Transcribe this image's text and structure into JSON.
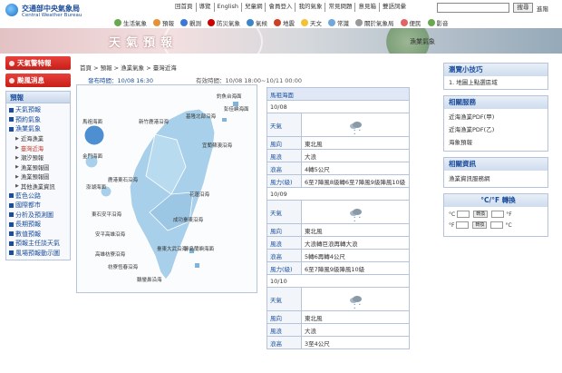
{
  "header": {
    "logo_title": "交通部中央氣象局",
    "logo_subtitle": "Central Weather Bureau",
    "top_links": [
      "回首頁",
      "導覽",
      "English",
      "兒童網",
      "會員登入",
      "我的氣象",
      "常見問題",
      "意見箱",
      "雙語詞彙"
    ],
    "search_button": "搜尋",
    "advanced_search": "進階",
    "nav": [
      {
        "label": "生活氣象",
        "icon": "leaf-icon",
        "color": "#6aa84f"
      },
      {
        "label": "預報",
        "icon": "forecast-icon",
        "color": "#e69138"
      },
      {
        "label": "觀測",
        "icon": "observation-icon",
        "color": "#3c78d8"
      },
      {
        "label": "防災氣象",
        "icon": "disaster-icon",
        "color": "#cc0000"
      },
      {
        "label": "氣候",
        "icon": "climate-icon",
        "color": "#3d85c6"
      },
      {
        "label": "地震",
        "icon": "earthquake-icon",
        "color": "#cc4125"
      },
      {
        "label": "天文",
        "icon": "astronomy-icon",
        "color": "#f1c232"
      },
      {
        "label": "常識",
        "icon": "knowledge-icon",
        "color": "#6fa8dc"
      },
      {
        "label": "關於氣象局",
        "icon": "about-icon",
        "color": "#999999"
      },
      {
        "label": "便民",
        "icon": "service-icon",
        "color": "#e06666"
      },
      {
        "label": "影音",
        "icon": "video-icon",
        "color": "#6aa84f"
      }
    ]
  },
  "banner": {
    "title": "天氣預報",
    "subtitle": "漁業氣象"
  },
  "sidebar": {
    "alerts": [
      "天氣警特報",
      "颱風消息"
    ],
    "section_title": "預報",
    "items_top": [
      "天氣預報",
      "預約氣象",
      "漁業氣象"
    ],
    "sub_items": [
      {
        "label": "近海漁業",
        "active": false
      },
      {
        "label": "臺灣近海",
        "active": true
      },
      {
        "label": "潮汐預報",
        "active": false
      },
      {
        "label": "漁業預報圖",
        "active": false
      },
      {
        "label": "漁業預報圖",
        "active": false
      },
      {
        "label": "其他漁業資訊",
        "active": false
      }
    ],
    "items_bottom": [
      "藍色公路",
      "國際都市",
      "分析及預測圖",
      "長期預報",
      "數值預報",
      "預報主任談天氣",
      "風場預報動示圖"
    ]
  },
  "breadcrumb": "首頁 > 預報 > 漁業氣象 > 臺灣近海",
  "publish_time": "發布時間：10/08 16:30",
  "valid_time": "有效時間：10/08 18:00~10/11 00:00",
  "map_labels": [
    "釣魚台海面",
    "彭佳嶼海面",
    "馬祖海面",
    "新竹鹿港沿海",
    "基隆北部沿海",
    "金門海面",
    "宜蘭蘇澳沿海",
    "鹿港東石沿海",
    "澎湖海面",
    "花蓮沿海",
    "東石安平沿海",
    "成功臺東沿海",
    "安平高雄沿海",
    "臺東大武沿海",
    "綠島蘭嶼海面",
    "高雄枋寮沿海",
    "枋寮恆春沿海",
    "鵝鑾鼻沿海"
  ],
  "forecast": {
    "area": "馬祖海面",
    "days": [
      {
        "date": "10/08",
        "wind_dir": "東北風",
        "wave": "大浪",
        "wave_height": "4轉5公尺",
        "wind_force": "6至7陣風8級轉6至7陣風9級陣風10級"
      },
      {
        "date": "10/09",
        "wind_dir": "東北風",
        "wave": "大浪轉巨浪再轉大浪",
        "wave_height": "5轉6再轉4公尺",
        "wind_force": "6至7陣風9級陣風10級"
      },
      {
        "date": "10/10",
        "wind_dir": "東北風",
        "wave": "大浪",
        "wave_height": "3至4公尺",
        "wind_force": ""
      }
    ],
    "labels": {
      "weather": "天氣",
      "wind_dir": "風向",
      "wave": "風浪",
      "wave_height": "浪高",
      "wind_force": "風力(級)"
    }
  },
  "right": {
    "tips_title": "瀏覽小技巧",
    "tips": [
      "1. 地圖上點選區域"
    ],
    "services_title": "相關服務",
    "services": [
      "近海漁業PDF(甲)",
      "近海漁業PDF(乙)",
      "海象預報"
    ],
    "info_title": "相關資訊",
    "info": [
      "漁業資訊服務網"
    ],
    "conv_title": "°C/°F 轉換",
    "conv_c": "°C",
    "conv_f": "°F",
    "conv_btn": "轉換"
  }
}
